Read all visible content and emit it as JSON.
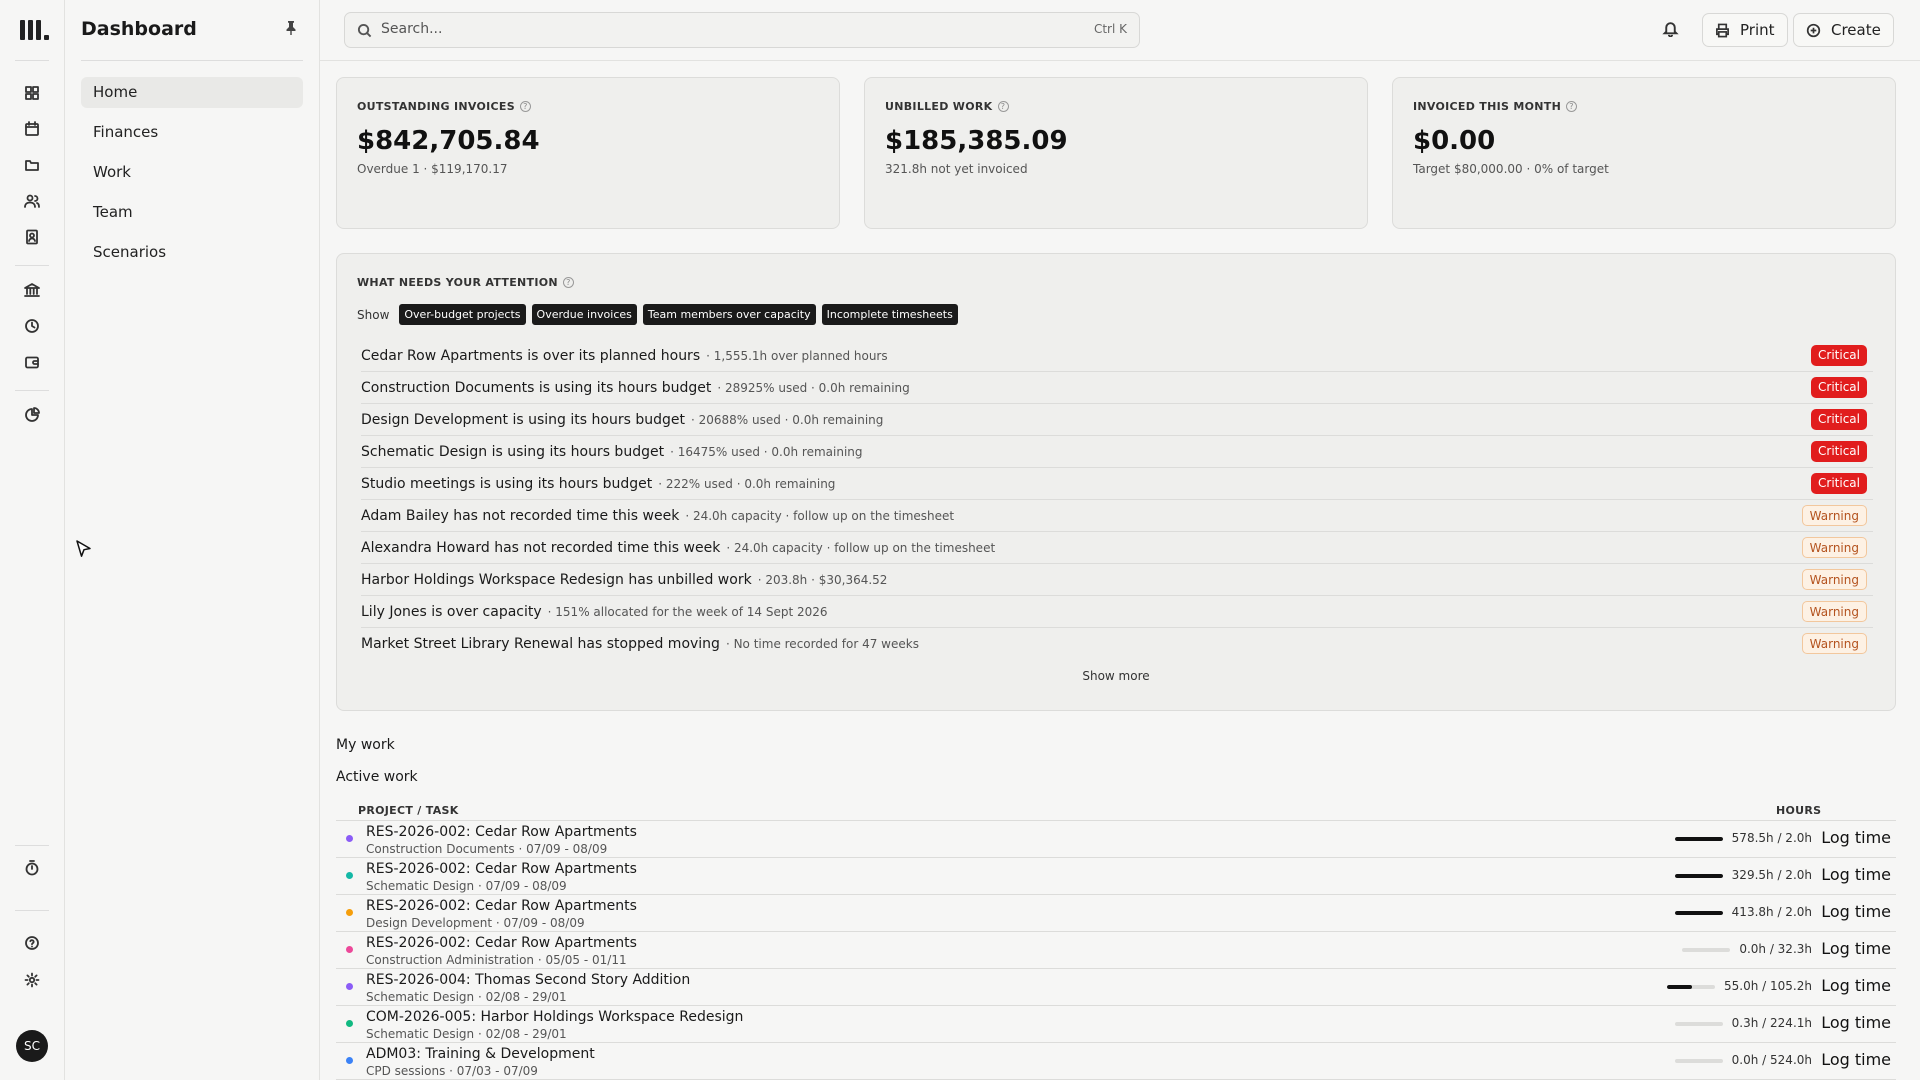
{
  "rail": {
    "icons": [
      "dashboard-icon",
      "calendar-icon",
      "folder-icon",
      "users-icon",
      "contacts-icon",
      "bank-icon",
      "clock-icon",
      "wallet-icon",
      "pie-chart-icon",
      "timer-icon",
      "help-icon",
      "settings-icon"
    ],
    "avatar_initials": "SC"
  },
  "sidenav": {
    "title": "Dashboard",
    "items": [
      {
        "label": "Home",
        "active": true
      },
      {
        "label": "Finances",
        "active": false
      },
      {
        "label": "Work",
        "active": false
      },
      {
        "label": "Team",
        "active": false
      },
      {
        "label": "Scenarios",
        "active": false
      }
    ]
  },
  "topbar": {
    "search_placeholder": "Search...",
    "search_shortcut": "Ctrl K",
    "print_label": "Print",
    "create_label": "Create"
  },
  "stats": [
    {
      "label": "OUTSTANDING INVOICES",
      "value": "$842,705.84",
      "sub": "Overdue 1 · $119,170.17"
    },
    {
      "label": "UNBILLED WORK",
      "value": "$185,385.09",
      "sub": "321.8h not yet invoiced"
    },
    {
      "label": "INVOICED THIS MONTH",
      "value": "$0.00",
      "sub": "Target $80,000.00 · 0% of target"
    }
  ],
  "attention": {
    "title": "WHAT NEEDS YOUR ATTENTION",
    "show_label": "Show",
    "filters": [
      "Over-budget projects",
      "Overdue invoices",
      "Team members over capacity",
      "Incomplete timesheets"
    ],
    "items": [
      {
        "title": "Cedar Row Apartments is over its planned hours",
        "meta": "· 1,555.1h over planned hours",
        "severity": "Critical"
      },
      {
        "title": "Construction Documents is using its hours budget",
        "meta": "· 28925% used · 0.0h remaining",
        "severity": "Critical"
      },
      {
        "title": "Design Development is using its hours budget",
        "meta": "· 20688% used · 0.0h remaining",
        "severity": "Critical"
      },
      {
        "title": "Schematic Design is using its hours budget",
        "meta": "· 16475% used · 0.0h remaining",
        "severity": "Critical"
      },
      {
        "title": "Studio meetings is using its hours budget",
        "meta": "· 222% used · 0.0h remaining",
        "severity": "Critical"
      },
      {
        "title": "Adam Bailey has not recorded time this week",
        "meta": "· 24.0h capacity · follow up on the timesheet",
        "severity": "Warning"
      },
      {
        "title": "Alexandra Howard has not recorded time this week",
        "meta": "· 24.0h capacity · follow up on the timesheet",
        "severity": "Warning"
      },
      {
        "title": "Harbor Holdings Workspace Redesign has unbilled work",
        "meta": "· 203.8h · $30,364.52",
        "severity": "Warning"
      },
      {
        "title": "Lily Jones is over capacity",
        "meta": "· 151% allocated for the week of 14 Sept 2026",
        "severity": "Warning"
      },
      {
        "title": "Market Street Library Renewal has stopped moving",
        "meta": "· No time recorded for 47 weeks",
        "severity": "Warning"
      }
    ],
    "show_more": "Show more"
  },
  "mywork": {
    "heading": "My work",
    "subheading": "Active work",
    "col_project": "PROJECT / TASK",
    "col_hours": "HOURS",
    "log_label": "Log time",
    "rows": [
      {
        "project": "RES-2026-002: Cedar Row Apartments",
        "task": "Construction Documents · 07/09 - 08/09",
        "hours": "578.5h / 2.0h",
        "progress": 1.0,
        "color": "#8b5cf6"
      },
      {
        "project": "RES-2026-002: Cedar Row Apartments",
        "task": "Schematic Design · 07/09 - 08/09",
        "hours": "329.5h / 2.0h",
        "progress": 1.0,
        "color": "#14b8a6"
      },
      {
        "project": "RES-2026-002: Cedar Row Apartments",
        "task": "Design Development · 07/09 - 08/09",
        "hours": "413.8h / 2.0h",
        "progress": 1.0,
        "color": "#f59e0b"
      },
      {
        "project": "RES-2026-002: Cedar Row Apartments",
        "task": "Construction Administration · 05/05 - 01/11",
        "hours": "0.0h / 32.3h",
        "progress": 0.0,
        "color": "#ec4899"
      },
      {
        "project": "RES-2026-004: Thomas Second Story Addition",
        "task": "Schematic Design · 02/08 - 29/01",
        "hours": "55.0h / 105.2h",
        "progress": 0.52,
        "color": "#8b5cf6"
      },
      {
        "project": "COM-2026-005: Harbor Holdings Workspace Redesign",
        "task": "Schematic Design · 02/08 - 29/01",
        "hours": "0.3h / 224.1h",
        "progress": 0.0,
        "color": "#10b981"
      },
      {
        "project": "ADM03: Training & Development",
        "task": "CPD sessions · 07/03 - 07/09",
        "hours": "0.0h / 524.0h",
        "progress": 0.0,
        "color": "#3b82f6"
      }
    ]
  }
}
